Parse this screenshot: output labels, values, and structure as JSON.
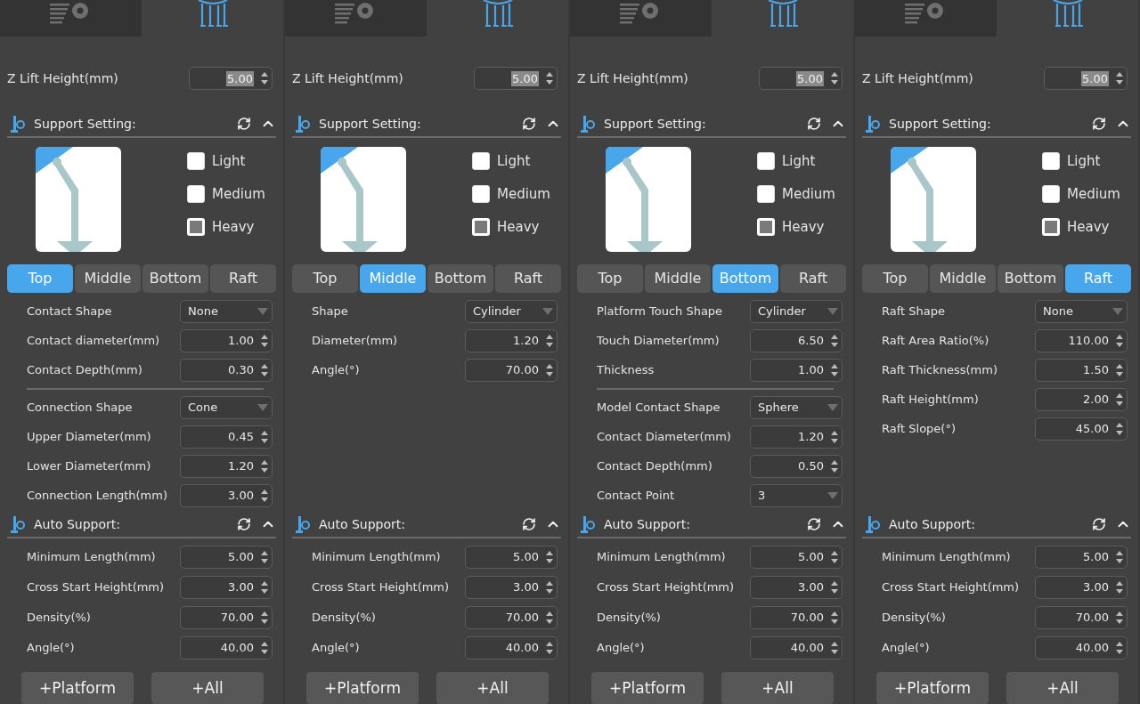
{
  "panels": [
    {
      "icon_tabs": [
        {
          "kind": "settings",
          "selected": false
        },
        {
          "kind": "support",
          "selected": true
        }
      ],
      "z_lift": {
        "label": "Z Lift Height(mm)",
        "value": "5.00"
      },
      "support_setting": {
        "title": "Support Setting:",
        "presets": [
          {
            "label": "Light",
            "checked": false
          },
          {
            "label": "Medium",
            "checked": false
          },
          {
            "label": "Heavy",
            "checked": true
          }
        ],
        "tabs": [
          {
            "label": "Top",
            "selected": true
          },
          {
            "label": "Middle",
            "selected": false
          },
          {
            "label": "Bottom",
            "selected": false
          },
          {
            "label": "Raft",
            "selected": false
          }
        ],
        "params": [
          {
            "kind": "dropdown",
            "label": "Contact Shape",
            "value": "None"
          },
          {
            "kind": "spin",
            "label": "Contact diameter(mm)",
            "value": "1.00"
          },
          {
            "kind": "spin",
            "label": "Contact Depth(mm)",
            "value": "0.30"
          },
          {
            "kind": "divider"
          },
          {
            "kind": "dropdown",
            "label": "Connection Shape",
            "value": "Cone"
          },
          {
            "kind": "spin",
            "label": "Upper Diameter(mm)",
            "value": "0.45"
          },
          {
            "kind": "spin",
            "label": "Lower Diameter(mm)",
            "value": "1.20"
          },
          {
            "kind": "spin",
            "label": "Connection Length(mm)",
            "value": "3.00"
          }
        ]
      },
      "auto_support": {
        "title": "Auto Support:",
        "params": [
          {
            "kind": "spin",
            "label": "Minimum Length(mm)",
            "value": "5.00"
          },
          {
            "kind": "spin",
            "label": "Cross Start Height(mm)",
            "value": "3.00"
          },
          {
            "kind": "spin",
            "label": "Density(%)",
            "value": "70.00"
          },
          {
            "kind": "spin",
            "label": "Angle(°)",
            "value": "40.00"
          }
        ]
      },
      "buttons": [
        "+Platform",
        "+All"
      ]
    },
    {
      "icon_tabs": [
        {
          "kind": "settings",
          "selected": false
        },
        {
          "kind": "support",
          "selected": true
        }
      ],
      "z_lift": {
        "label": "Z Lift Height(mm)",
        "value": "5.00"
      },
      "support_setting": {
        "title": "Support Setting:",
        "presets": [
          {
            "label": "Light",
            "checked": false
          },
          {
            "label": "Medium",
            "checked": false
          },
          {
            "label": "Heavy",
            "checked": true
          }
        ],
        "tabs": [
          {
            "label": "Top",
            "selected": false
          },
          {
            "label": "Middle",
            "selected": true
          },
          {
            "label": "Bottom",
            "selected": false
          },
          {
            "label": "Raft",
            "selected": false
          }
        ],
        "params": [
          {
            "kind": "dropdown",
            "label": "Shape",
            "value": "Cylinder"
          },
          {
            "kind": "spin",
            "label": "Diameter(mm)",
            "value": "1.20"
          },
          {
            "kind": "spin",
            "label": "Angle(°)",
            "value": "70.00"
          }
        ]
      },
      "auto_support": {
        "title": "Auto Support:",
        "params": [
          {
            "kind": "spin",
            "label": "Minimum Length(mm)",
            "value": "5.00"
          },
          {
            "kind": "spin",
            "label": "Cross Start Height(mm)",
            "value": "3.00"
          },
          {
            "kind": "spin",
            "label": "Density(%)",
            "value": "70.00"
          },
          {
            "kind": "spin",
            "label": "Angle(°)",
            "value": "40.00"
          }
        ]
      },
      "buttons": [
        "+Platform",
        "+All"
      ]
    },
    {
      "icon_tabs": [
        {
          "kind": "settings",
          "selected": false
        },
        {
          "kind": "support",
          "selected": true
        }
      ],
      "z_lift": {
        "label": "Z Lift Height(mm)",
        "value": "5.00"
      },
      "support_setting": {
        "title": "Support Setting:",
        "presets": [
          {
            "label": "Light",
            "checked": false
          },
          {
            "label": "Medium",
            "checked": false
          },
          {
            "label": "Heavy",
            "checked": true
          }
        ],
        "tabs": [
          {
            "label": "Top",
            "selected": false
          },
          {
            "label": "Middle",
            "selected": false
          },
          {
            "label": "Bottom",
            "selected": true
          },
          {
            "label": "Raft",
            "selected": false
          }
        ],
        "params": [
          {
            "kind": "dropdown",
            "label": "Platform Touch Shape",
            "value": "Cylinder"
          },
          {
            "kind": "spin",
            "label": "Touch Diameter(mm)",
            "value": "6.50"
          },
          {
            "kind": "spin",
            "label": "Thickness",
            "value": "1.00"
          },
          {
            "kind": "divider"
          },
          {
            "kind": "dropdown",
            "label": "Model Contact Shape",
            "value": "Sphere"
          },
          {
            "kind": "spin",
            "label": "Contact Diameter(mm)",
            "value": "1.20"
          },
          {
            "kind": "spin",
            "label": "Contact Depth(mm)",
            "value": "0.50"
          },
          {
            "kind": "dropdown",
            "label": "Contact Point",
            "value": "3"
          }
        ]
      },
      "auto_support": {
        "title": "Auto Support:",
        "params": [
          {
            "kind": "spin",
            "label": "Minimum Length(mm)",
            "value": "5.00"
          },
          {
            "kind": "spin",
            "label": "Cross Start Height(mm)",
            "value": "3.00"
          },
          {
            "kind": "spin",
            "label": "Density(%)",
            "value": "70.00"
          },
          {
            "kind": "spin",
            "label": "Angle(°)",
            "value": "40.00"
          }
        ]
      },
      "buttons": [
        "+Platform",
        "+All"
      ]
    },
    {
      "icon_tabs": [
        {
          "kind": "settings",
          "selected": false
        },
        {
          "kind": "support",
          "selected": true
        }
      ],
      "z_lift": {
        "label": "Z Lift Height(mm)",
        "value": "5.00"
      },
      "support_setting": {
        "title": "Support Setting:",
        "presets": [
          {
            "label": "Light",
            "checked": false
          },
          {
            "label": "Medium",
            "checked": false
          },
          {
            "label": "Heavy",
            "checked": true
          }
        ],
        "tabs": [
          {
            "label": "Top",
            "selected": false
          },
          {
            "label": "Middle",
            "selected": false
          },
          {
            "label": "Bottom",
            "selected": false
          },
          {
            "label": "Raft",
            "selected": true
          }
        ],
        "params": [
          {
            "kind": "dropdown",
            "label": "Raft Shape",
            "value": "None"
          },
          {
            "kind": "spin",
            "label": "Raft Area Ratio(%)",
            "value": "110.00"
          },
          {
            "kind": "spin",
            "label": "Raft Thickness(mm)",
            "value": "1.50"
          },
          {
            "kind": "spin",
            "label": "Raft Height(mm)",
            "value": "2.00"
          },
          {
            "kind": "spin",
            "label": "Raft Slope(°)",
            "value": "45.00"
          }
        ]
      },
      "auto_support": {
        "title": "Auto Support:",
        "params": [
          {
            "kind": "spin",
            "label": "Minimum Length(mm)",
            "value": "5.00"
          },
          {
            "kind": "spin",
            "label": "Cross Start Height(mm)",
            "value": "3.00"
          },
          {
            "kind": "spin",
            "label": "Density(%)",
            "value": "70.00"
          },
          {
            "kind": "spin",
            "label": "Angle(°)",
            "value": "40.00"
          }
        ]
      },
      "buttons": [
        "+Platform",
        "+All"
      ]
    }
  ]
}
